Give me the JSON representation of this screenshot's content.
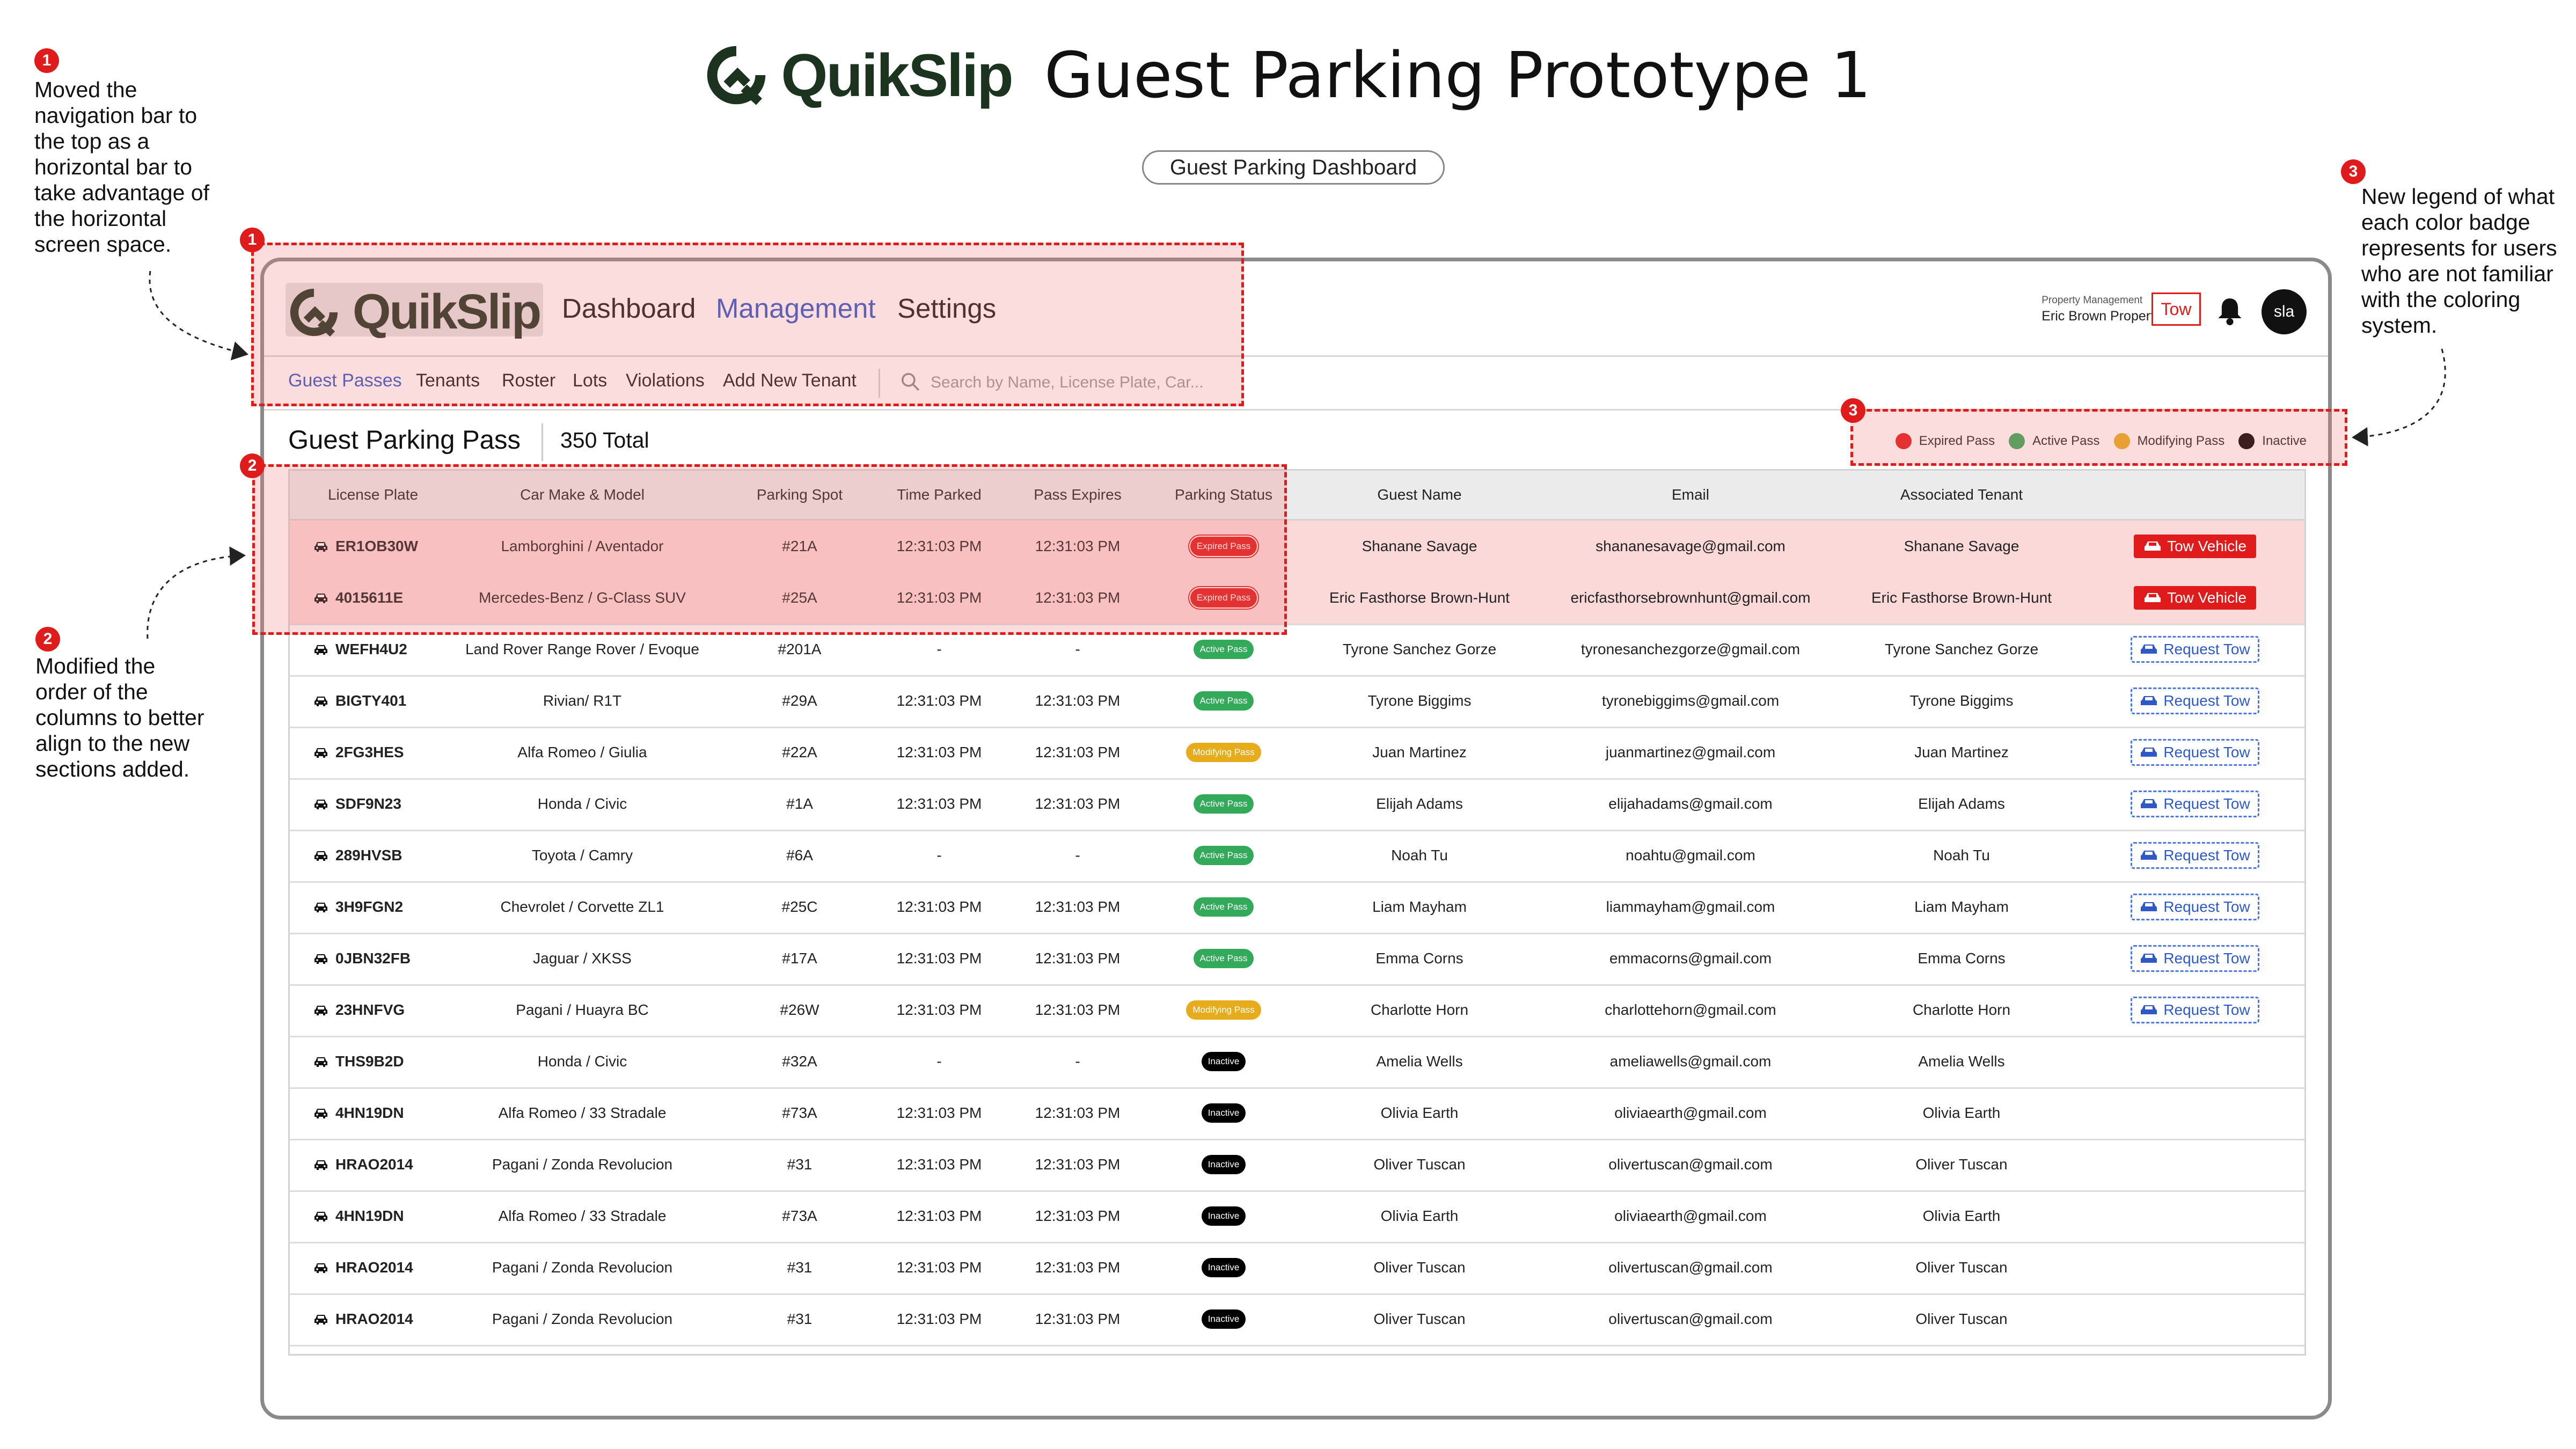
{
  "header": {
    "brand": "QuikSlip",
    "title": "Guest Parking Prototype 1",
    "chip": "Guest Parking Dashboard"
  },
  "annotations": [
    {
      "num": "1",
      "text": [
        "Moved the",
        "navigation bar to",
        "the top as a",
        "horizontal bar to",
        "take advantage of",
        "the horizontal",
        "screen space."
      ]
    },
    {
      "num": "2",
      "text": [
        "Modified the",
        "order of the",
        "columns to better",
        "align to the new",
        "sections added."
      ]
    },
    {
      "num": "3",
      "text": [
        "New legend of what",
        "each color badge",
        "represents for users",
        "who are not familiar",
        "with the coloring",
        "system."
      ]
    }
  ],
  "app": {
    "brand": "QuikSlip",
    "nav": [
      "Dashboard",
      "Management",
      "Settings"
    ],
    "property_label": "Property Management",
    "property_name": "Eric Brown Properties",
    "tow_button": "Tow",
    "avatar": "sla",
    "subnav": [
      "Guest Passes",
      "Tenants",
      "Roster",
      "Lots",
      "Violations",
      "Add New Tenant"
    ],
    "search_placeholder": "Search by Name, License Plate, Car..."
  },
  "pass": {
    "title": "Guest Parking Pass",
    "total": "350 Total"
  },
  "legend": [
    {
      "label": "Expired Pass",
      "color": "#e01b1b"
    },
    {
      "label": "Active Pass",
      "color": "#33a95a"
    },
    {
      "label": "Modifying Pass",
      "color": "#e6ac1c"
    },
    {
      "label": "Inactive",
      "color": "#000000"
    }
  ],
  "table": {
    "columns": [
      "License Plate",
      "Car Make & Model",
      "Parking Spot",
      "Time Parked",
      "Pass Expires",
      "Parking Status",
      "Guest Name",
      "Email",
      "Associated Tenant"
    ],
    "rows": [
      {
        "plate": "ER1OB30W",
        "car": "Lamborghini / Aventador",
        "spot": "#21A",
        "parked": "12:31:03 PM",
        "expires": "12:31:03 PM",
        "status": "Expired Pass",
        "status_type": "expired",
        "guest": "Shanane Savage",
        "email": "shananesavage@gmail.com",
        "tenant": "Shanane Savage",
        "action": "Tow Vehicle",
        "action_type": "tow"
      },
      {
        "plate": "4015611E",
        "car": "Mercedes-Benz / G-Class SUV",
        "spot": "#25A",
        "parked": "12:31:03 PM",
        "expires": "12:31:03 PM",
        "status": "Expired Pass",
        "status_type": "expired",
        "guest": "Eric Fasthorse Brown-Hunt",
        "email": "ericfasthorsebrownhunt@gmail.com",
        "tenant": "Eric Fasthorse Brown-Hunt",
        "action": "Tow Vehicle",
        "action_type": "tow"
      },
      {
        "plate": "WEFH4U2",
        "car": "Land Rover Range Rover / Evoque",
        "spot": "#201A",
        "parked": "-",
        "expires": "-",
        "status": "Active Pass",
        "status_type": "active",
        "guest": "Tyrone Sanchez Gorze",
        "email": "tyronesanchezgorze@gmail.com",
        "tenant": "Tyrone Sanchez Gorze",
        "action": "Request Tow",
        "action_type": "request"
      },
      {
        "plate": "BIGTY401",
        "car": "Rivian/ R1T",
        "spot": "#29A",
        "parked": "12:31:03 PM",
        "expires": "12:31:03 PM",
        "status": "Active Pass",
        "status_type": "active",
        "guest": "Tyrone Biggims",
        "email": "tyronebiggims@gmail.com",
        "tenant": "Tyrone Biggims",
        "action": "Request Tow",
        "action_type": "request"
      },
      {
        "plate": "2FG3HES",
        "car": "Alfa Romeo / Giulia",
        "spot": "#22A",
        "parked": "12:31:03 PM",
        "expires": "12:31:03 PM",
        "status": "Modifying Pass",
        "status_type": "modifying",
        "guest": "Juan Martinez",
        "email": "juanmartinez@gmail.com",
        "tenant": "Juan Martinez",
        "action": "Request Tow",
        "action_type": "request"
      },
      {
        "plate": "SDF9N23",
        "car": "Honda / Civic",
        "spot": "#1A",
        "parked": "12:31:03 PM",
        "expires": "12:31:03 PM",
        "status": "Active Pass",
        "status_type": "active",
        "guest": "Elijah Adams",
        "email": "elijahadams@gmail.com",
        "tenant": "Elijah Adams",
        "action": "Request Tow",
        "action_type": "request"
      },
      {
        "plate": "289HVSB",
        "car": "Toyota / Camry",
        "spot": "#6A",
        "parked": "-",
        "expires": "-",
        "status": "Active Pass",
        "status_type": "active",
        "guest": "Noah Tu",
        "email": "noahtu@gmail.com",
        "tenant": "Noah Tu",
        "action": "Request Tow",
        "action_type": "request"
      },
      {
        "plate": "3H9FGN2",
        "car": "Chevrolet / Corvette ZL1",
        "spot": "#25C",
        "parked": "12:31:03 PM",
        "expires": "12:31:03 PM",
        "status": "Active Pass",
        "status_type": "active",
        "guest": "Liam Mayham",
        "email": "liammayham@gmail.com",
        "tenant": "Liam Mayham",
        "action": "Request Tow",
        "action_type": "request"
      },
      {
        "plate": "0JBN32FB",
        "car": "Jaguar / XKSS",
        "spot": "#17A",
        "parked": "12:31:03 PM",
        "expires": "12:31:03 PM",
        "status": "Active Pass",
        "status_type": "active",
        "guest": "Emma Corns",
        "email": "emmacorns@gmail.com",
        "tenant": "Emma Corns",
        "action": "Request Tow",
        "action_type": "request"
      },
      {
        "plate": "23HNFVG",
        "car": "Pagani / Huayra BC",
        "spot": "#26W",
        "parked": "12:31:03 PM",
        "expires": "12:31:03 PM",
        "status": "Modifying Pass",
        "status_type": "modifying",
        "guest": "Charlotte Horn",
        "email": "charlottehorn@gmail.com",
        "tenant": "Charlotte Horn",
        "action": "Request Tow",
        "action_type": "request"
      },
      {
        "plate": "THS9B2D",
        "car": "Honda / Civic",
        "spot": "#32A",
        "parked": "-",
        "expires": "-",
        "status": "Inactive",
        "status_type": "inactive",
        "guest": "Amelia Wells",
        "email": "ameliawells@gmail.com",
        "tenant": "Amelia Wells",
        "action": "",
        "action_type": "none"
      },
      {
        "plate": "4HN19DN",
        "car": "Alfa Romeo / 33 Stradale",
        "spot": "#73A",
        "parked": "12:31:03 PM",
        "expires": "12:31:03 PM",
        "status": "Inactive",
        "status_type": "inactive",
        "guest": "Olivia Earth",
        "email": "oliviaearth@gmail.com",
        "tenant": "Olivia Earth",
        "action": "",
        "action_type": "none"
      },
      {
        "plate": "HRAO2014",
        "car": "Pagani / Zonda Revolucion",
        "spot": "#31",
        "parked": "12:31:03 PM",
        "expires": "12:31:03 PM",
        "status": "Inactive",
        "status_type": "inactive",
        "guest": "Oliver Tuscan",
        "email": "olivertuscan@gmail.com",
        "tenant": "Oliver Tuscan",
        "action": "",
        "action_type": "none"
      },
      {
        "plate": "4HN19DN",
        "car": "Alfa Romeo / 33 Stradale",
        "spot": "#73A",
        "parked": "12:31:03 PM",
        "expires": "12:31:03 PM",
        "status": "Inactive",
        "status_type": "inactive",
        "guest": "Olivia Earth",
        "email": "oliviaearth@gmail.com",
        "tenant": "Olivia Earth",
        "action": "",
        "action_type": "none"
      },
      {
        "plate": "HRAO2014",
        "car": "Pagani / Zonda Revolucion",
        "spot": "#31",
        "parked": "12:31:03 PM",
        "expires": "12:31:03 PM",
        "status": "Inactive",
        "status_type": "inactive",
        "guest": "Oliver Tuscan",
        "email": "olivertuscan@gmail.com",
        "tenant": "Oliver Tuscan",
        "action": "",
        "action_type": "none"
      },
      {
        "plate": "HRAO2014",
        "car": "Pagani / Zonda Revolucion",
        "spot": "#31",
        "parked": "12:31:03 PM",
        "expires": "12:31:03 PM",
        "status": "Inactive",
        "status_type": "inactive",
        "guest": "Oliver Tuscan",
        "email": "olivertuscan@gmail.com",
        "tenant": "Oliver Tuscan",
        "action": "",
        "action_type": "none"
      }
    ]
  },
  "colors": {
    "accent": "#2f59c7",
    "danger": "#e01b1b",
    "brand": "#1c3320"
  },
  "icons": {
    "logo": "quikslip-logo-icon",
    "bell": "bell-icon",
    "search": "search-icon",
    "car": "car-icon"
  }
}
